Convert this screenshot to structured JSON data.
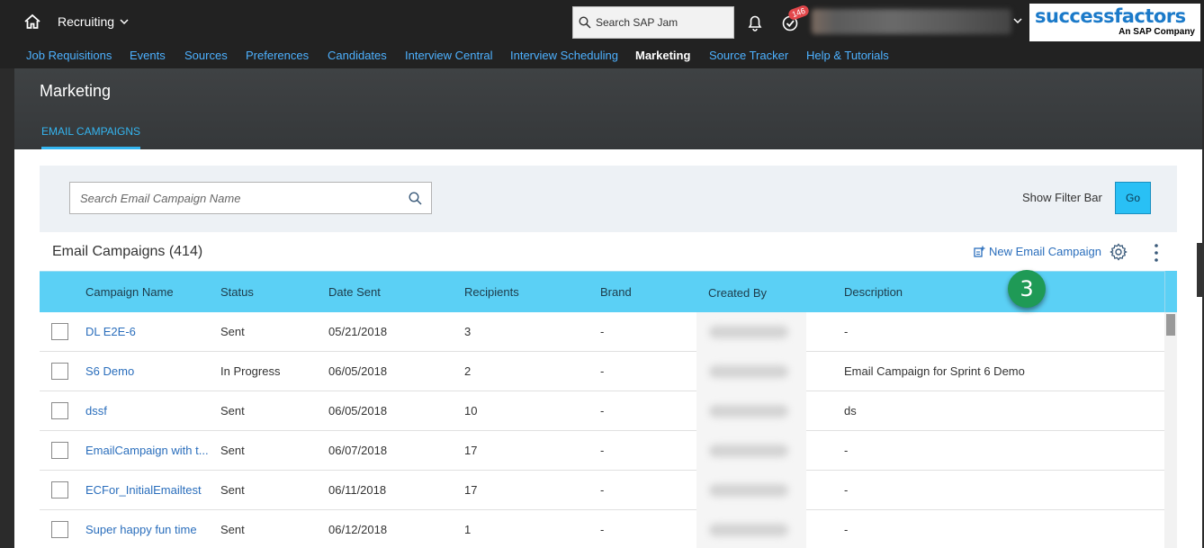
{
  "topbar": {
    "app_name": "Recruiting",
    "search_placeholder": "Search SAP Jam",
    "todo_count": "146",
    "logo_text": "successfactors",
    "logo_sub": "An SAP Company"
  },
  "nav": {
    "items": [
      "Job Requisitions",
      "Events",
      "Sources",
      "Preferences",
      "Candidates",
      "Interview Central",
      "Interview Scheduling",
      "Marketing",
      "Source Tracker",
      "Help & Tutorials"
    ],
    "active": "Marketing"
  },
  "header": {
    "title": "Marketing",
    "tab": "EMAIL CAMPAIGNS"
  },
  "filter": {
    "search_placeholder": "Search Email Campaign Name",
    "show_filter_label": "Show Filter Bar",
    "go_label": "Go"
  },
  "table": {
    "title": "Email Campaigns (414)",
    "new_label": "New Email Campaign",
    "columns": [
      "Campaign Name",
      "Status",
      "Date Sent",
      "Recipients",
      "Brand",
      "Created By",
      "Description"
    ],
    "rows": [
      {
        "name": "DL E2E-6",
        "status": "Sent",
        "date": "05/21/2018",
        "recipients": "3",
        "brand": "-",
        "description": "-"
      },
      {
        "name": "S6 Demo",
        "status": "In Progress",
        "date": "06/05/2018",
        "recipients": "2",
        "brand": "-",
        "description": "Email Campaign for Sprint 6 Demo"
      },
      {
        "name": "dssf",
        "status": "Sent",
        "date": "06/05/2018",
        "recipients": "10",
        "brand": "-",
        "description": "ds"
      },
      {
        "name": "EmailCampaign with t...",
        "status": "Sent",
        "date": "06/07/2018",
        "recipients": "17",
        "brand": "-",
        "description": "-"
      },
      {
        "name": "ECFor_InitialEmailtest",
        "status": "Sent",
        "date": "06/11/2018",
        "recipients": "17",
        "brand": "-",
        "description": "-"
      },
      {
        "name": "Super happy fun time",
        "status": "Sent",
        "date": "06/12/2018",
        "recipients": "1",
        "brand": "-",
        "description": "-"
      }
    ]
  },
  "annotation": {
    "step": "3",
    "color": "#1f9a56"
  },
  "colors": {
    "header_bg": "#222222",
    "nav_link": "#4db1ff",
    "table_header": "#5bd0f5",
    "go_button": "#29c0f5",
    "link": "#2a6ebc"
  }
}
